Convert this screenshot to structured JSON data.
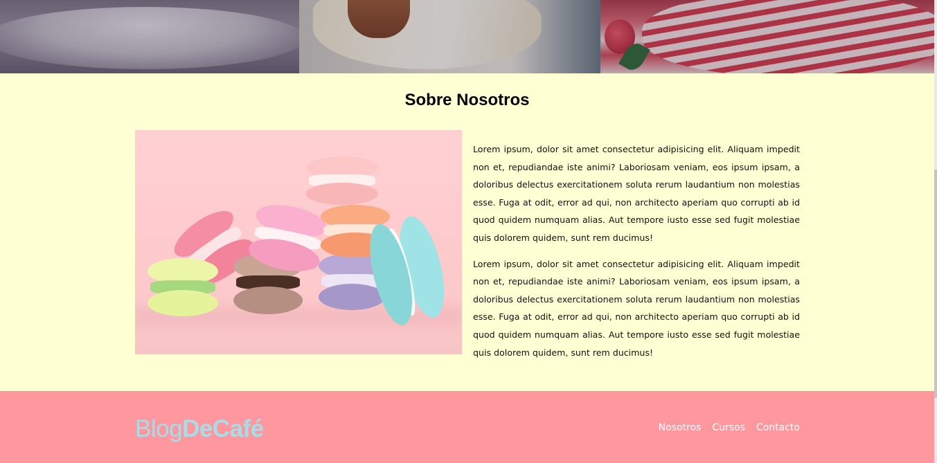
{
  "about": {
    "title": "Sobre Nosotros",
    "image_alt": "macarons",
    "paragraphs": [
      "Lorem ipsum, dolor sit amet consectetur adipisicing elit. Aliquam impedit non et, repudiandae iste animi? Laboriosam veniam, eos ipsum ipsam, a doloribus delectus exercitationem soluta rerum laudantium non molestias esse. Fuga at odit, error ad qui, non architecto aperiam quo corrupti ab id quod quidem numquam alias. Aut tempore iusto esse sed fugit molestiae quis dolorem quidem, sunt rem ducimus!",
      "Lorem ipsum, dolor sit amet consectetur adipisicing elit. Aliquam impedit non et, repudiandae iste animi? Laboriosam veniam, eos ipsum ipsam, a doloribus delectus exercitationem soluta rerum laudantium non molestias esse. Fuga at odit, error ad qui, non architecto aperiam quo corrupti ab id quod quidem numquam alias. Aut tempore iusto esse sed fugit molestiae quis dolorem quidem, sunt rem ducimus!"
    ]
  },
  "footer": {
    "logo_regular": "Blog",
    "logo_bold": "DeCafé",
    "nav": [
      "Nosotros",
      "Cursos",
      "Contacto"
    ]
  },
  "colors": {
    "page_background": "#ffffd4",
    "footer_background": "#ff979e",
    "logo_color": "#a8dce7",
    "nav_link_color": "#ffffff"
  }
}
